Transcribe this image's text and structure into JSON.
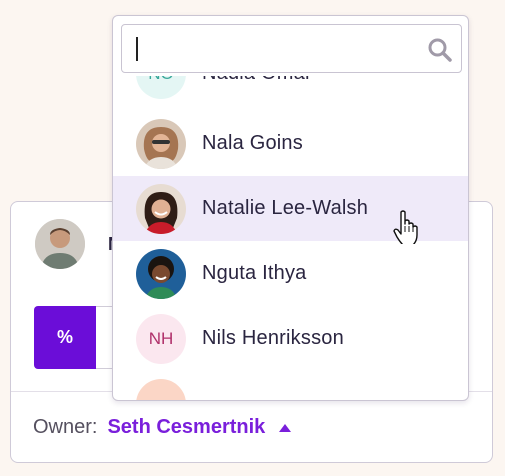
{
  "search": {
    "value": ""
  },
  "people": [
    {
      "name": "Nadia Omar",
      "initials": "NO",
      "avatar_type": "initials",
      "avatar_bg": "#e4f6f4",
      "highlight": false,
      "partial": "top"
    },
    {
      "name": "Nala Goins",
      "initials": "",
      "avatar_type": "photo",
      "avatar_bg": "#b89a86",
      "highlight": false
    },
    {
      "name": "Natalie Lee-Walsh",
      "initials": "",
      "avatar_type": "photo",
      "avatar_bg": "#6a3a2e",
      "highlight": true
    },
    {
      "name": "Nguta Ithya",
      "initials": "",
      "avatar_type": "photo",
      "avatar_bg": "#2c6ba0",
      "highlight": false
    },
    {
      "name": "Nils Henriksson",
      "initials": "NH",
      "avatar_type": "initials",
      "avatar_bg": "#fbe7ef",
      "highlight": false
    },
    {
      "name": "",
      "initials": "",
      "avatar_type": "initials",
      "avatar_bg": "#fbd6c6",
      "highlight": false,
      "partial": "bottom"
    }
  ],
  "card": {
    "name_initial": "N",
    "percent_label": "%",
    "owner_label": "Owner:",
    "owner_value": "Seth Cesmertnik"
  },
  "colors": {
    "accent": "#6b0dd8",
    "owner_link": "#7a1fdb",
    "highlight_row": "#efeaf9"
  },
  "icons": {
    "search": "magnifier-icon",
    "owner_toggle": "caret-up-icon",
    "pointer": "hand-pointer-icon"
  }
}
